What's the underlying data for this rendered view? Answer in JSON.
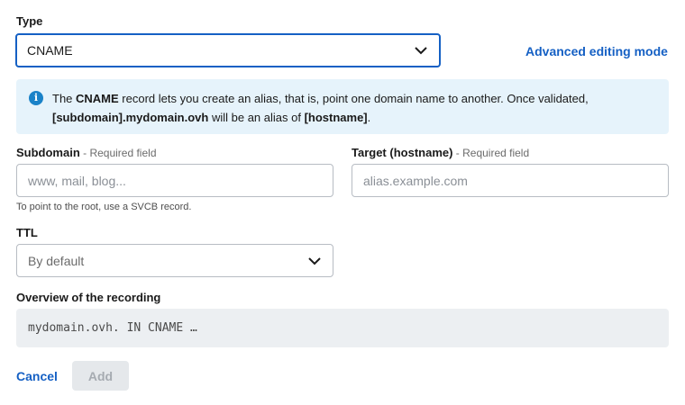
{
  "type_field": {
    "label": "Type",
    "value": "CNAME"
  },
  "advanced_link": "Advanced editing mode",
  "info": {
    "icon_glyph": "i",
    "pre": "The ",
    "record": "CNAME",
    "mid": " record lets you create an alias, that is, point one domain name to another. Once validated, ",
    "alias_source": "[subdomain].mydomain.ovh",
    "between": " will be an alias of ",
    "alias_target": "[hostname]",
    "end": "."
  },
  "subdomain": {
    "label": "Subdomain",
    "required": " - Required field",
    "placeholder": "www, mail, blog...",
    "hint": "To point to the root, use a SVCB record."
  },
  "target": {
    "label": "Target (hostname)",
    "required": " - Required field",
    "placeholder": "alias.example.com"
  },
  "ttl": {
    "label": "TTL",
    "value": "By default"
  },
  "overview": {
    "label": "Overview of the recording",
    "value": "mydomain.ovh. IN CNAME …"
  },
  "actions": {
    "cancel": "Cancel",
    "add": "Add"
  }
}
